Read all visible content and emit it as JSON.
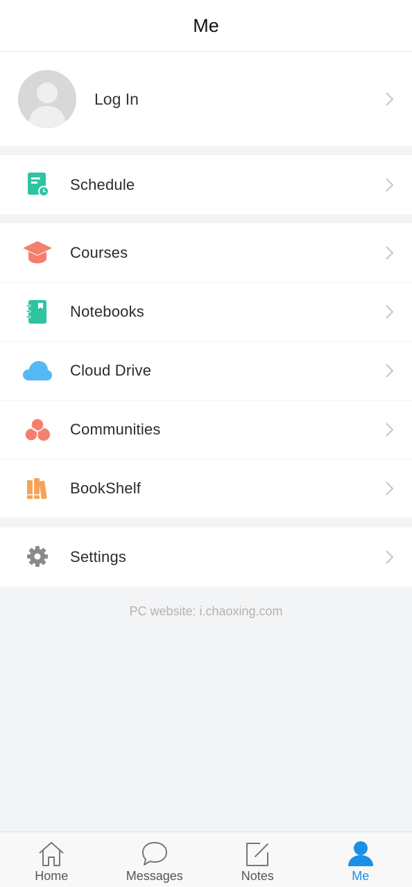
{
  "header": {
    "title": "Me"
  },
  "profile": {
    "login_label": "Log In"
  },
  "groups": {
    "schedule": {
      "label": "Schedule"
    },
    "courses": {
      "label": "Courses"
    },
    "notebooks": {
      "label": "Notebooks"
    },
    "cloud_drive": {
      "label": "Cloud Drive"
    },
    "communities": {
      "label": "Communities"
    },
    "bookshelf": {
      "label": "BookShelf"
    },
    "settings": {
      "label": "Settings"
    }
  },
  "footer_note": "PC website: i.chaoxing.com",
  "tabbar": {
    "tabs": [
      {
        "label": "Home",
        "icon": "home-icon",
        "active": false
      },
      {
        "label": "Messages",
        "icon": "chat-bubble-icon",
        "active": false
      },
      {
        "label": "Notes",
        "icon": "edit-note-icon",
        "active": false
      },
      {
        "label": "Me",
        "icon": "person-icon",
        "active": true
      }
    ]
  },
  "colors": {
    "accent": "#1a8fe8",
    "schedule": "#2ec4a2",
    "courses": "#f47f6e",
    "notebooks": "#2ec4a2",
    "cloud": "#55b8f2",
    "communities": "#f47f6e",
    "bookshelf": "#f5a35a",
    "settings": "#8a8a8a"
  }
}
